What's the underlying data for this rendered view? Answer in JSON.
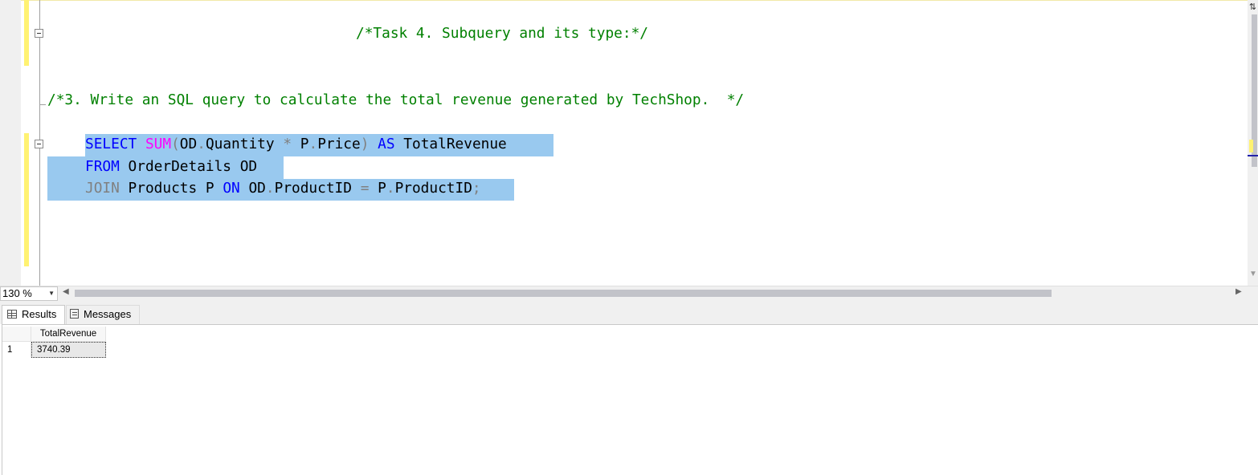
{
  "editor": {
    "line_task_comment": "/*Task 4. Subquery and its type:*/",
    "line_question_comment": "/*3. Write an SQL query to calculate the total revenue generated by TechShop.  */",
    "sql": {
      "l1_select": "SELECT",
      "l1_sum": "SUM",
      "l1_paren_open": "(",
      "l1_od": "OD",
      "l1_dot1": ".",
      "l1_quantity": "Quantity",
      "l1_star": "*",
      "l1_p": "P",
      "l1_dot2": ".",
      "l1_price": "Price",
      "l1_paren_close": ")",
      "l1_as": "AS",
      "l1_alias": "TotalRevenue",
      "l2_from": "FROM",
      "l2_table": "OrderDetails OD",
      "l3_join": "JOIN",
      "l3_table": "Products P",
      "l3_on": "ON",
      "l3_od": "OD",
      "l3_dot1": ".",
      "l3_productid1": "ProductID",
      "l3_eq": "=",
      "l3_p": "P",
      "l3_dot2": ".",
      "l3_productid2": "ProductID",
      "l3_semi": ";"
    },
    "split_glyph": "⇅",
    "scroll_down_glyph": "▼"
  },
  "statusbar": {
    "zoom": "130 %",
    "zoom_arrow": "▼",
    "scroll_left_glyph": "◀",
    "scroll_right_glyph": "▶"
  },
  "tabs": {
    "results_label": "Results",
    "messages_label": "Messages"
  },
  "results": {
    "columns": [
      "TotalRevenue"
    ],
    "rows": [
      {
        "row_number": "1",
        "values": [
          "3740.39"
        ]
      }
    ]
  },
  "colors": {
    "keyword": "#0000ff",
    "function": "#ff00ff",
    "operator": "#808080",
    "comment": "#008000",
    "selection": "#99c9ef",
    "change_marker": "#fff272"
  }
}
